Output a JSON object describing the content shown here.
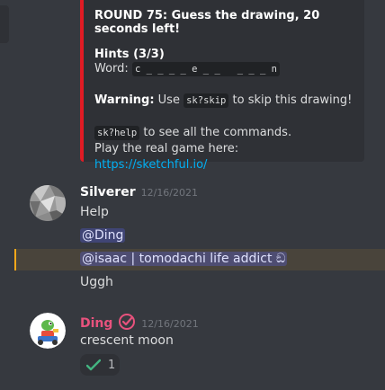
{
  "embed": {
    "round_title": "ROUND 75: Guess the drawing, 20 seconds left!",
    "hints_title": "Hints (3/3)",
    "word_label": "Word:",
    "word_pattern": "c _ _ _ _ e _ _   _ _ _ n",
    "warning_label": "Warning:",
    "warning_pre": "Use",
    "warning_code": "sk?skip",
    "warning_post": "to skip this drawing!",
    "help_code": "sk?help",
    "help_text": "to see all the commands.",
    "play_text": "Play the real game here:",
    "play_link": "https://sketchful.io/"
  },
  "messages": [
    {
      "username": "Silverer",
      "timestamp": "12/16/2021",
      "lines": [
        "Help",
        "@Ding",
        "@isaac | tomodachi life addict ඞ",
        "Uggh"
      ]
    },
    {
      "username": "Ding",
      "timestamp": "12/16/2021",
      "text": "crescent moon",
      "reaction_count": "1"
    }
  ],
  "colors": {
    "background": "#36393f",
    "embed_bg": "#2f3136",
    "embed_border": "#e01b24",
    "ding_name": "#e8527d",
    "mention_bg": "rgba(88,101,242,0.3)",
    "highlight_border": "#faa81a",
    "link": "#00b0f4"
  },
  "icons": [
    "verified-badge-icon",
    "check-reaction-icon"
  ]
}
